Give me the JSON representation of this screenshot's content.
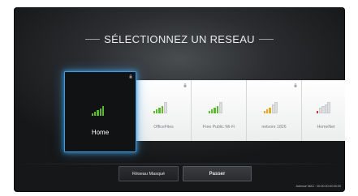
{
  "header": {
    "title": "SÉLECTIONNEZ UN RESEAU"
  },
  "networks": [
    {
      "name": "Home",
      "signal_bars": 5,
      "signal_color": "#5cb82e",
      "locked": true
    },
    {
      "name": "OfficeFiles",
      "signal_bars": 4,
      "signal_color": "#5cb82e",
      "locked": true
    },
    {
      "name": "Free Public Wi-Fi",
      "signal_bars": 4,
      "signal_color": "#5cb82e",
      "locked": false
    },
    {
      "name": "netvore 1826",
      "signal_bars": 3,
      "signal_color": "#e3a92a",
      "locked": true
    },
    {
      "name": "HomeNet",
      "signal_bars": 1,
      "signal_color": "#d8342c",
      "locked": false
    }
  ],
  "footer": {
    "hidden_network_label": "Réseau Masqué",
    "skip_label": "Passer",
    "mac_address": "Adresse MAC : 00:00:00:00:00:00"
  }
}
